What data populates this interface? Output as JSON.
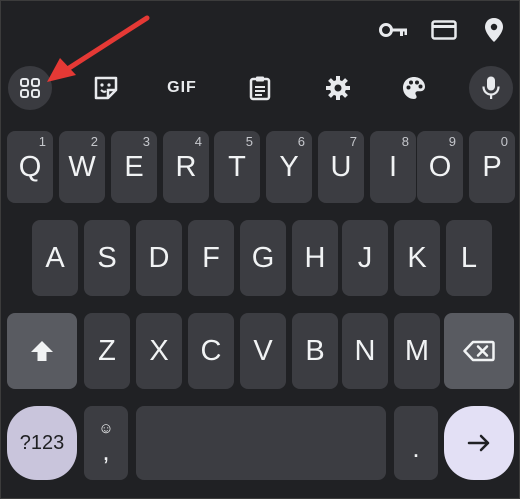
{
  "autofill_bar": {
    "icons": [
      "key-icon",
      "card-icon",
      "location-pin-icon"
    ]
  },
  "toolbar": {
    "apps_grid_icon": "apps-grid-icon",
    "sticker_icon": "sticker-icon",
    "gif_label": "GIF",
    "clipboard_icon": "clipboard-icon",
    "settings_icon": "gear-icon",
    "theme_icon": "palette-icon",
    "mic_icon": "microphone-icon"
  },
  "keyboard": {
    "row1": [
      {
        "label": "Q",
        "hint": "1"
      },
      {
        "label": "W",
        "hint": "2"
      },
      {
        "label": "E",
        "hint": "3"
      },
      {
        "label": "R",
        "hint": "4"
      },
      {
        "label": "T",
        "hint": "5"
      },
      {
        "label": "Y",
        "hint": "6"
      },
      {
        "label": "U",
        "hint": "7"
      },
      {
        "label": "I",
        "hint": "8"
      },
      {
        "label": "O",
        "hint": "9"
      },
      {
        "label": "P",
        "hint": "0"
      }
    ],
    "row2": [
      "A",
      "S",
      "D",
      "F",
      "G",
      "H",
      "J",
      "K",
      "L"
    ],
    "row3": [
      "Z",
      "X",
      "C",
      "V",
      "B",
      "N",
      "M"
    ],
    "symbols_label": "?123",
    "comma_label": ",",
    "comma_emoji": "☺",
    "period_label": "."
  },
  "annotation": {
    "arrow_color": "#e53935"
  },
  "colors": {
    "background": "#202124",
    "key": "#3c3d42",
    "modifier_key": "#595b61",
    "symbols_key": "#c9c5dc",
    "enter_key": "#e3e0f5"
  }
}
